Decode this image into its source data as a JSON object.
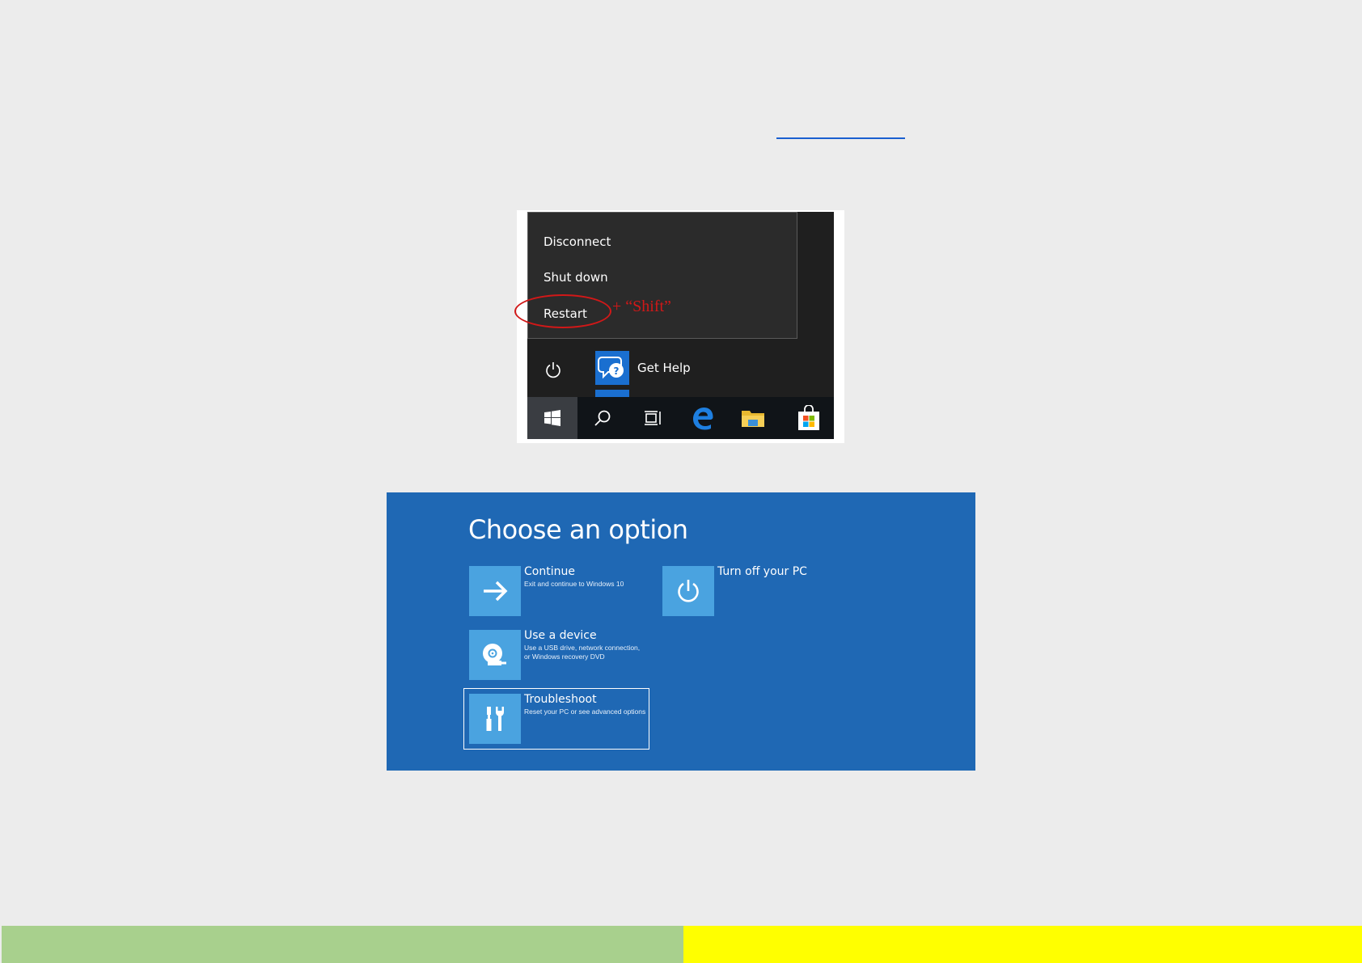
{
  "power_menu": {
    "items": [
      "Disconnect",
      "Shut down",
      "Restart"
    ],
    "annotation": "+ “Shift”",
    "get_help_label": "Get Help",
    "taskbar_icons": [
      "windows-start-icon",
      "search-icon",
      "task-view-icon",
      "edge-icon",
      "file-explorer-icon",
      "store-icon"
    ]
  },
  "recovery": {
    "title": "Choose an option",
    "options": [
      {
        "name": "Continue",
        "desc": "Exit and continue to Windows 10",
        "icon": "arrow-right-icon"
      },
      {
        "name": "Turn off your PC",
        "desc": "",
        "icon": "power-icon"
      },
      {
        "name": "Use a device",
        "desc": "Use a USB drive, network connection, or Windows recovery DVD",
        "icon": "disc-icon"
      },
      {
        "name": "Troubleshoot",
        "desc": "Reset your PC or see advanced options",
        "icon": "tools-icon"
      }
    ],
    "selected": "Troubleshoot"
  },
  "colors": {
    "recovery_background": "#1f68b4",
    "tile": "#4aa3e0",
    "annotation": "#d11818",
    "bar_left": "#a8d08d",
    "bar_right": "#ffff00"
  }
}
